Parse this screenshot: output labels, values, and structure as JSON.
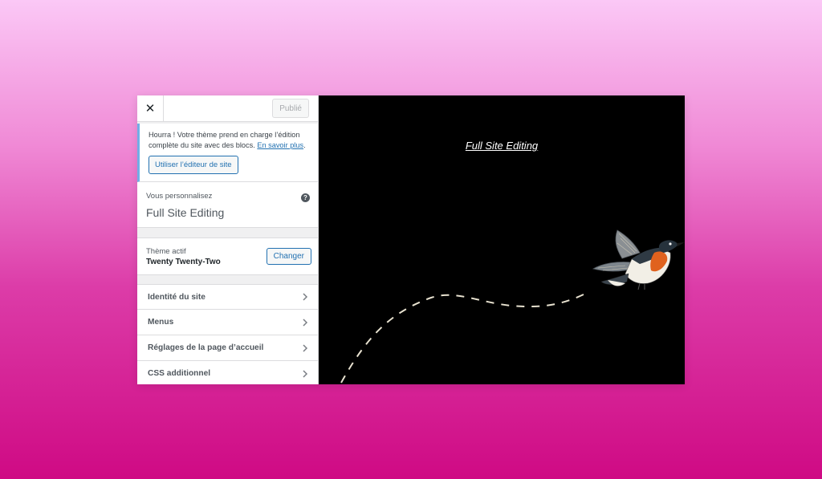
{
  "header": {
    "close_icon": "close-icon",
    "publish_label": "Publié"
  },
  "notice": {
    "text": "Hourra ! Votre thème prend en charge l’édition complète du site avec des blocs.",
    "link": "En savoir plus",
    "link_suffix": ".",
    "button": "Utiliser l’éditeur de site"
  },
  "customizing": {
    "label": "Vous personnalisez",
    "site_name": "Full Site Editing",
    "help_icon": "help-icon"
  },
  "theme": {
    "label": "Thème actif",
    "name": "Twenty Twenty-Two",
    "change_button": "Changer"
  },
  "menu": {
    "items": [
      {
        "label": "Identité du site"
      },
      {
        "label": "Menus"
      },
      {
        "label": "Réglages de la page d’accueil"
      },
      {
        "label": "CSS additionnel"
      }
    ],
    "chevron_icon": "chevron-right-icon"
  },
  "preview": {
    "site_title": "Full Site Editing",
    "background": "#000000"
  },
  "colors": {
    "accent": "#2271b1",
    "notice_border": "#72aee6"
  }
}
